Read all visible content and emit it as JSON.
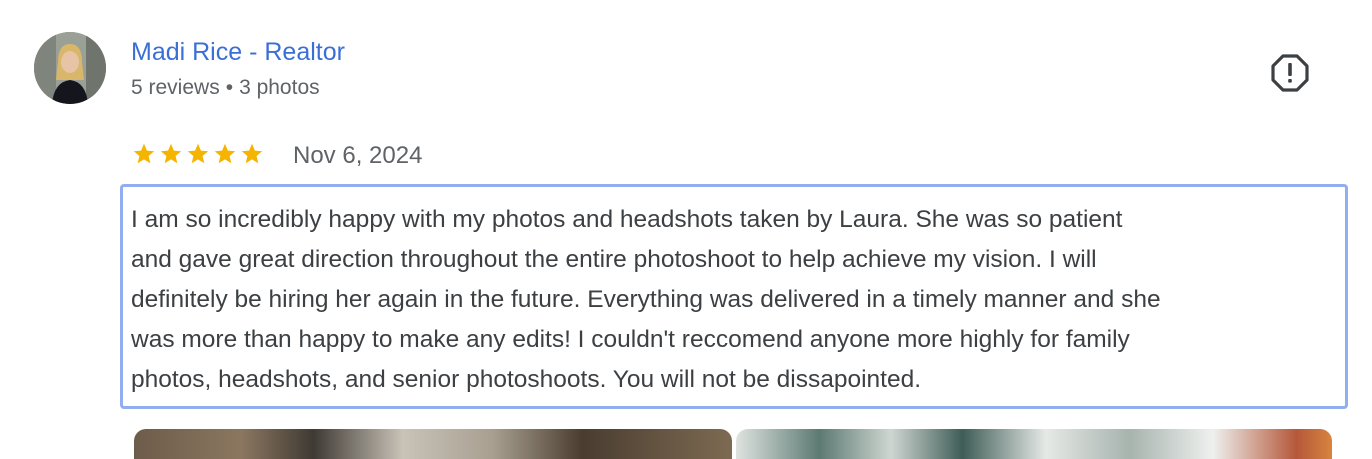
{
  "author": {
    "name": "Madi Rice - Realtor",
    "reviews": "5 reviews",
    "separator": "•",
    "photos": "3 photos"
  },
  "icons": {
    "avatar": "avatar-photo",
    "report": "report-octagon-icon",
    "star": "star-icon"
  },
  "review": {
    "rating": 5,
    "rating_max": 5,
    "date": "Nov 6, 2024",
    "text": "I am so incredibly happy with my photos and headshots taken by Laura. She was so patient\nand gave great direction throughout the entire photoshoot to help achieve my vision. I will\ndefinitely be hiring her again in the future. Everything was delivered in a timely manner and she\nwas more than happy to make any edits! I couldn't reccomend anyone more highly for family\nphotos, headshots, and senior photoshoots. You will not be dissapointed."
  },
  "colors": {
    "name": "#3b6fd6",
    "star": "#f4b400",
    "selection_border": "#91aef0",
    "secondary_text": "#5f6368"
  }
}
